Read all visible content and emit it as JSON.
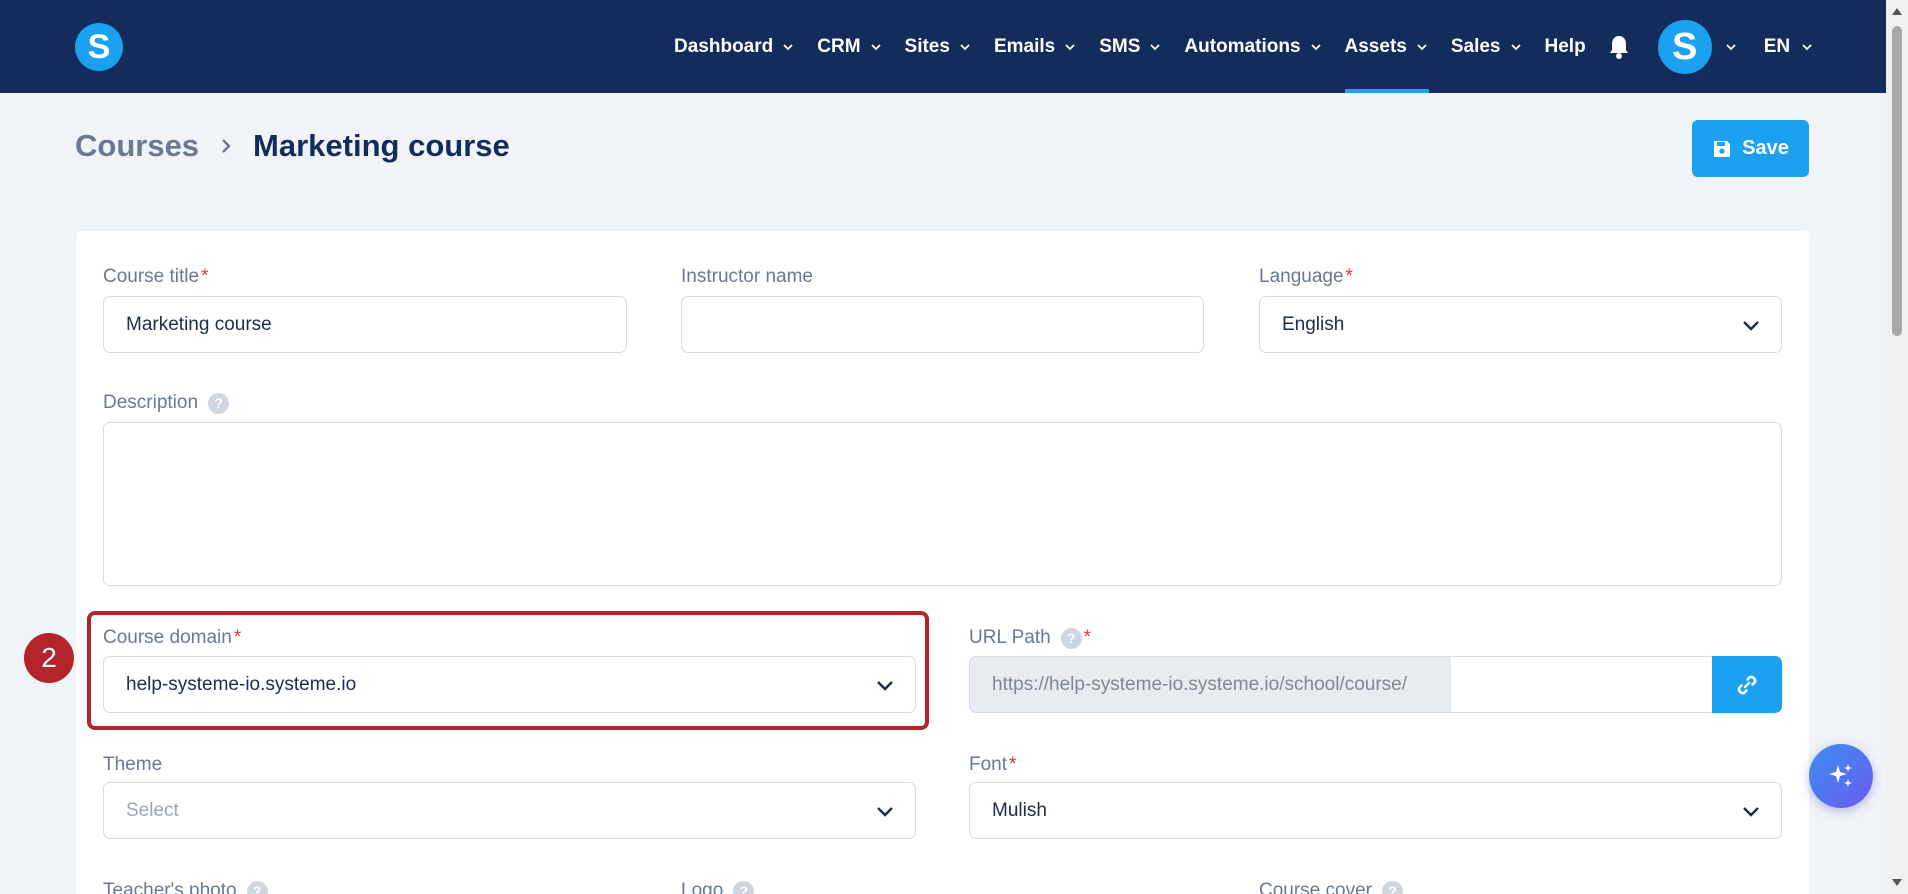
{
  "nav": {
    "logo_letter": "S",
    "items": [
      {
        "label": "Dashboard",
        "has_dropdown": true
      },
      {
        "label": "CRM",
        "has_dropdown": true
      },
      {
        "label": "Sites",
        "has_dropdown": true
      },
      {
        "label": "Emails",
        "has_dropdown": true
      },
      {
        "label": "SMS",
        "has_dropdown": true
      },
      {
        "label": "Automations",
        "has_dropdown": true
      },
      {
        "label": "Assets",
        "has_dropdown": true,
        "active": true
      },
      {
        "label": "Sales",
        "has_dropdown": true
      },
      {
        "label": "Help",
        "has_dropdown": false
      }
    ],
    "avatar_letter": "S",
    "language": "EN",
    "icons": [
      "bell-icon"
    ]
  },
  "header": {
    "breadcrumb_parent": "Courses",
    "breadcrumb_current": "Marketing course",
    "save_label": "Save"
  },
  "form": {
    "course_title": {
      "label": "Course title",
      "required_mark": "*",
      "value": "Marketing course"
    },
    "instructor_name": {
      "label": "Instructor name",
      "value": ""
    },
    "language": {
      "label": "Language",
      "required_mark": "*",
      "value": "English"
    },
    "description": {
      "label": "Description",
      "help": "?",
      "value": ""
    },
    "course_domain": {
      "label": "Course domain",
      "required_mark": "*",
      "value": "help-systeme-io.systeme.io"
    },
    "url_path": {
      "label": "URL Path",
      "help": "?",
      "required_mark": "*",
      "prefix": "https://help-systeme-io.systeme.io/school/course/",
      "value": ""
    },
    "theme": {
      "label": "Theme",
      "placeholder": "Select"
    },
    "font": {
      "label": "Font",
      "required_mark": "*",
      "value": "Mulish"
    },
    "teachers_photo": {
      "label": "Teacher's photo",
      "help": "?"
    },
    "logo": {
      "label": "Logo",
      "help": "?"
    },
    "course_cover": {
      "label": "Course cover",
      "help": "?"
    }
  },
  "annotation": {
    "step_number": "2"
  },
  "colors": {
    "nav_bg": "#142c5c",
    "accent": "#1aa1f0",
    "required": "#e0383e",
    "highlight": "#b3252b"
  }
}
